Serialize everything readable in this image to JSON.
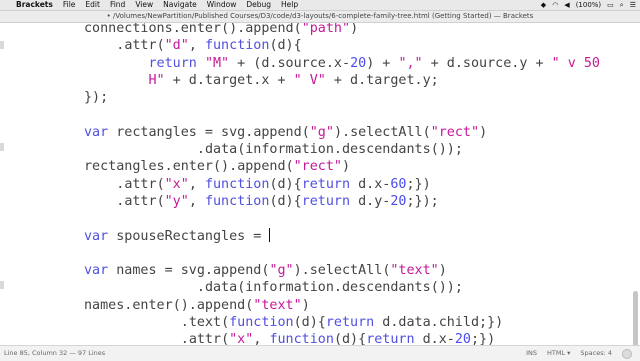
{
  "menubar": {
    "app": "Brackets",
    "items": [
      "File",
      "Edit",
      "Find",
      "View",
      "Navigate",
      "Window",
      "Debug",
      "Help"
    ],
    "battery": "(100%)"
  },
  "window": {
    "title": "• /Volumes/NewPartition/Published Courses/D3/code/d3-layouts/6-complete-family-tree.html (Getting Started) — Brackets"
  },
  "editor": {
    "lines": [
      [
        {
          "t": "connections",
          "c": "fn"
        },
        {
          "t": ".",
          "c": ""
        },
        {
          "t": "enter",
          "c": "fn"
        },
        {
          "t": "().",
          "c": ""
        },
        {
          "t": "append",
          "c": "fn"
        },
        {
          "t": "(",
          "c": ""
        },
        {
          "t": "\"path\"",
          "c": "str"
        },
        {
          "t": ")",
          "c": ""
        }
      ],
      [
        {
          "t": "    .",
          "c": ""
        },
        {
          "t": "attr",
          "c": "fn"
        },
        {
          "t": "(",
          "c": ""
        },
        {
          "t": "\"d\"",
          "c": "str"
        },
        {
          "t": ", ",
          "c": ""
        },
        {
          "t": "function",
          "c": "kw"
        },
        {
          "t": "(d){",
          "c": ""
        }
      ],
      [
        {
          "t": "        ",
          "c": ""
        },
        {
          "t": "return",
          "c": "kw"
        },
        {
          "t": " ",
          "c": ""
        },
        {
          "t": "\"M\"",
          "c": "str"
        },
        {
          "t": " + (d.source.x-",
          "c": ""
        },
        {
          "t": "20",
          "c": "num"
        },
        {
          "t": ") + ",
          "c": ""
        },
        {
          "t": "\",\"",
          "c": "str"
        },
        {
          "t": " + d.source.y + ",
          "c": ""
        },
        {
          "t": "\" v 50",
          "c": "str"
        }
      ],
      [
        {
          "t": "        ",
          "c": ""
        },
        {
          "t": "H\"",
          "c": "str"
        },
        {
          "t": " + d.target.x + ",
          "c": ""
        },
        {
          "t": "\" V\"",
          "c": "str"
        },
        {
          "t": " + d.target.y;",
          "c": ""
        }
      ],
      [
        {
          "t": "});",
          "c": ""
        }
      ],
      [],
      [
        {
          "t": "var",
          "c": "kw"
        },
        {
          "t": " rectangles = svg.",
          "c": ""
        },
        {
          "t": "append",
          "c": "fn"
        },
        {
          "t": "(",
          "c": ""
        },
        {
          "t": "\"g\"",
          "c": "str"
        },
        {
          "t": ").",
          "c": ""
        },
        {
          "t": "selectAll",
          "c": "fn"
        },
        {
          "t": "(",
          "c": ""
        },
        {
          "t": "\"rect\"",
          "c": "str"
        },
        {
          "t": ")",
          "c": ""
        }
      ],
      [
        {
          "t": "              .",
          "c": ""
        },
        {
          "t": "data",
          "c": "fn"
        },
        {
          "t": "(information.",
          "c": ""
        },
        {
          "t": "descendants",
          "c": "fn"
        },
        {
          "t": "());",
          "c": ""
        }
      ],
      [
        {
          "t": "rectangles.",
          "c": ""
        },
        {
          "t": "enter",
          "c": "fn"
        },
        {
          "t": "().",
          "c": ""
        },
        {
          "t": "append",
          "c": "fn"
        },
        {
          "t": "(",
          "c": ""
        },
        {
          "t": "\"rect\"",
          "c": "str"
        },
        {
          "t": ")",
          "c": ""
        }
      ],
      [
        {
          "t": "    .",
          "c": ""
        },
        {
          "t": "attr",
          "c": "fn"
        },
        {
          "t": "(",
          "c": ""
        },
        {
          "t": "\"x\"",
          "c": "str"
        },
        {
          "t": ", ",
          "c": ""
        },
        {
          "t": "function",
          "c": "kw"
        },
        {
          "t": "(d){",
          "c": ""
        },
        {
          "t": "return",
          "c": "kw"
        },
        {
          "t": " d.x-",
          "c": ""
        },
        {
          "t": "60",
          "c": "num"
        },
        {
          "t": ";})",
          "c": ""
        }
      ],
      [
        {
          "t": "    .",
          "c": ""
        },
        {
          "t": "attr",
          "c": "fn"
        },
        {
          "t": "(",
          "c": ""
        },
        {
          "t": "\"y\"",
          "c": "str"
        },
        {
          "t": ", ",
          "c": ""
        },
        {
          "t": "function",
          "c": "kw"
        },
        {
          "t": "(d){",
          "c": ""
        },
        {
          "t": "return",
          "c": "kw"
        },
        {
          "t": " d.y-",
          "c": ""
        },
        {
          "t": "20",
          "c": "num"
        },
        {
          "t": ";});",
          "c": ""
        }
      ],
      [],
      [
        {
          "t": "var",
          "c": "kw"
        },
        {
          "t": " spouseRectangles = ",
          "c": ""
        },
        {
          "t": "",
          "c": "caret"
        }
      ],
      [],
      [
        {
          "t": "var",
          "c": "kw"
        },
        {
          "t": " names = svg.",
          "c": ""
        },
        {
          "t": "append",
          "c": "fn"
        },
        {
          "t": "(",
          "c": ""
        },
        {
          "t": "\"g\"",
          "c": "str"
        },
        {
          "t": ").",
          "c": ""
        },
        {
          "t": "selectAll",
          "c": "fn"
        },
        {
          "t": "(",
          "c": ""
        },
        {
          "t": "\"text\"",
          "c": "str"
        },
        {
          "t": ")",
          "c": ""
        }
      ],
      [
        {
          "t": "              .",
          "c": ""
        },
        {
          "t": "data",
          "c": "fn"
        },
        {
          "t": "(information.",
          "c": ""
        },
        {
          "t": "descendants",
          "c": "fn"
        },
        {
          "t": "());",
          "c": ""
        }
      ],
      [
        {
          "t": "names.",
          "c": ""
        },
        {
          "t": "enter",
          "c": "fn"
        },
        {
          "t": "().",
          "c": ""
        },
        {
          "t": "append",
          "c": "fn"
        },
        {
          "t": "(",
          "c": ""
        },
        {
          "t": "\"text\"",
          "c": "str"
        },
        {
          "t": ")",
          "c": ""
        }
      ],
      [
        {
          "t": "            .",
          "c": ""
        },
        {
          "t": "text",
          "c": "fn"
        },
        {
          "t": "(",
          "c": ""
        },
        {
          "t": "function",
          "c": "kw"
        },
        {
          "t": "(d){",
          "c": ""
        },
        {
          "t": "return",
          "c": "kw"
        },
        {
          "t": " d.data.child;})",
          "c": ""
        }
      ],
      [
        {
          "t": "            .",
          "c": ""
        },
        {
          "t": "attr",
          "c": "fn"
        },
        {
          "t": "(",
          "c": ""
        },
        {
          "t": "\"x\"",
          "c": "str"
        },
        {
          "t": ", ",
          "c": ""
        },
        {
          "t": "function",
          "c": "kw"
        },
        {
          "t": "(d){",
          "c": ""
        },
        {
          "t": "return",
          "c": "kw"
        },
        {
          "t": " d.x-",
          "c": ""
        },
        {
          "t": "20",
          "c": "num"
        },
        {
          "t": ";})",
          "c": ""
        }
      ]
    ]
  },
  "statusbar": {
    "position": "Line 85, Column 32 — 97 Lines",
    "mode": "INS",
    "language": "HTML ▾",
    "spaces": "Spaces: 4"
  },
  "colors": {
    "keyword": "#5050e0",
    "string": "#c41a9a",
    "number": "#4a4af0"
  }
}
